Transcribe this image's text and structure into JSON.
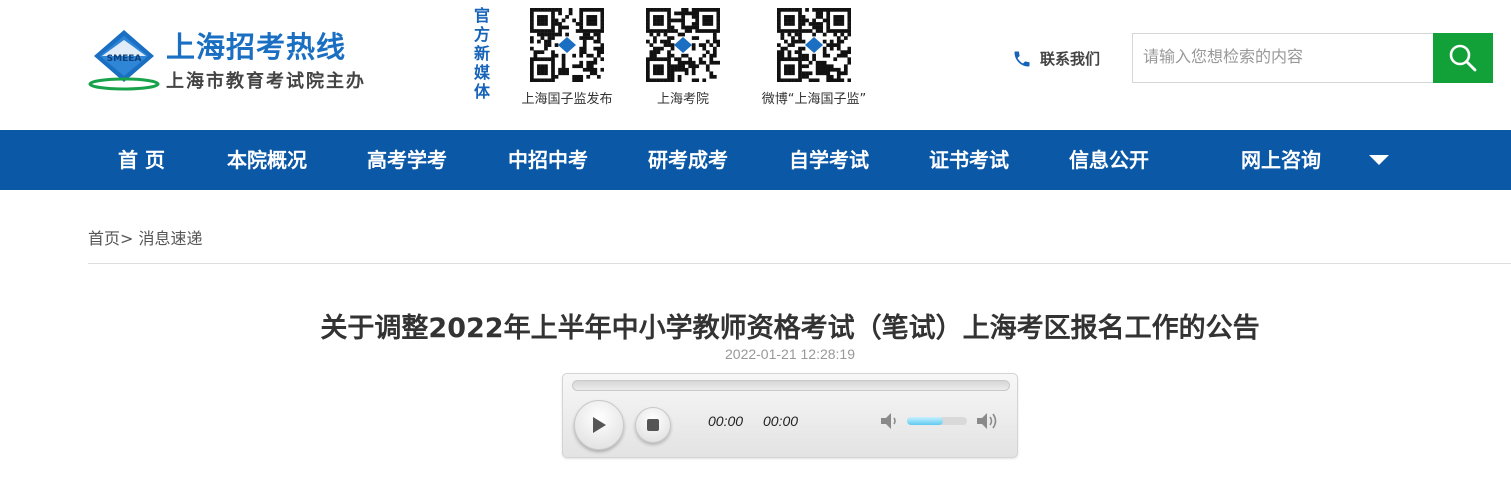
{
  "header": {
    "logo": {
      "title": "上海招考热线",
      "subtitle": "上海市教育考试院主办",
      "emblem_text": "SMEEA"
    },
    "media_label": "官方新媒体",
    "qr_codes": [
      {
        "caption": "上海国子监发布"
      },
      {
        "caption": "上海考院"
      },
      {
        "caption": "微博“上海国子监”"
      }
    ],
    "contact_label": "联系我们",
    "search": {
      "placeholder": "请输入您想检索的内容",
      "value": "",
      "icon": "search-icon"
    }
  },
  "nav": {
    "items": [
      "首 页",
      "本院概况",
      "高考学考",
      "中招中考",
      "研考成考",
      "自学考试",
      "证书考试",
      "信息公开",
      "网上咨询"
    ],
    "more_icon": "caret-down-icon"
  },
  "breadcrumb": {
    "home": "首页",
    "separator": ">",
    "current": "消息速递"
  },
  "article": {
    "title": "关于调整2022年上半年中小学教师资格考试（笔试）上海考区报名工作的公告",
    "date": "2022-01-21 12:28:19"
  },
  "player": {
    "current_time": "00:00",
    "duration": "00:00",
    "progress": 0,
    "volume": 0.6
  },
  "colors": {
    "brand_blue": "#0b58a6",
    "logo_blue": "#1a6fc2",
    "search_green": "#12a038"
  }
}
